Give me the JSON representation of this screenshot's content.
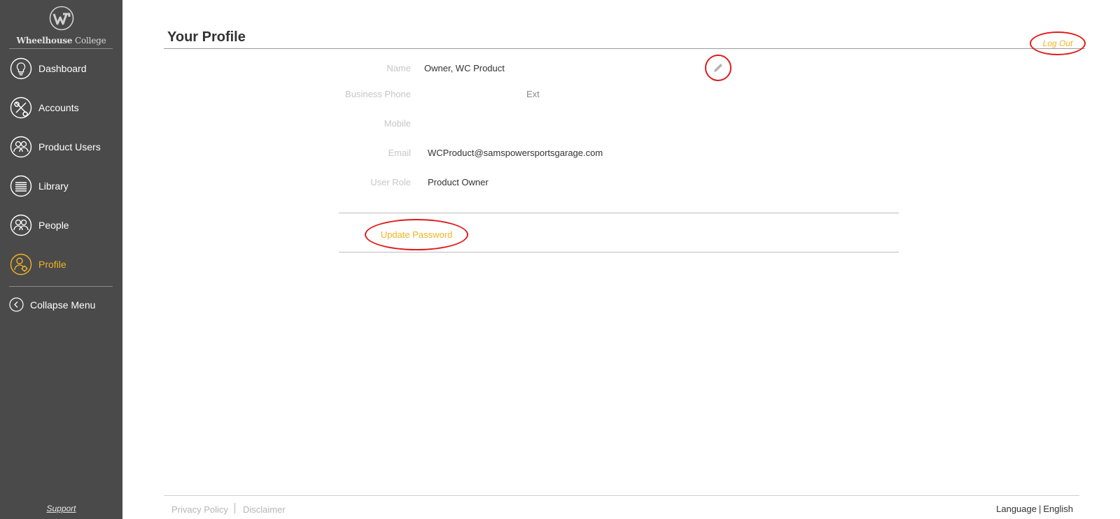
{
  "brand": {
    "name_bold": "Wheelhouse",
    "name_light": " College"
  },
  "sidebar": {
    "items": [
      {
        "label": "Dashboard",
        "icon": "lightbulb-icon"
      },
      {
        "label": "Accounts",
        "icon": "tools-icon"
      },
      {
        "label": "Product Users",
        "icon": "users-icon"
      },
      {
        "label": "Library",
        "icon": "library-icon"
      },
      {
        "label": "People",
        "icon": "people-icon"
      },
      {
        "label": "Profile",
        "icon": "profile-gear-icon",
        "active": true
      }
    ],
    "collapse_label": "Collapse Menu",
    "support_label": "Support"
  },
  "header": {
    "title": "Your Profile",
    "logout_label": "Log Out"
  },
  "profile": {
    "name_label": "Name",
    "name_value": "Owner, WC Product",
    "business_phone_label": "Business Phone",
    "ext_label": "Ext",
    "mobile_label": "Mobile",
    "email_label": "Email",
    "email_value": "WCProduct@samspowersportsgarage.com",
    "role_label": "User Role",
    "role_value": "Product Owner",
    "update_password_label": "Update Password"
  },
  "footer": {
    "privacy_label": "Privacy Policy",
    "disclaimer_label": "Disclaimer",
    "language_label": "Language",
    "language_value": "English"
  },
  "colors": {
    "sidebar_bg": "#4a4a4a",
    "accent": "#f0b323",
    "highlight_ring": "#e01b1b"
  }
}
